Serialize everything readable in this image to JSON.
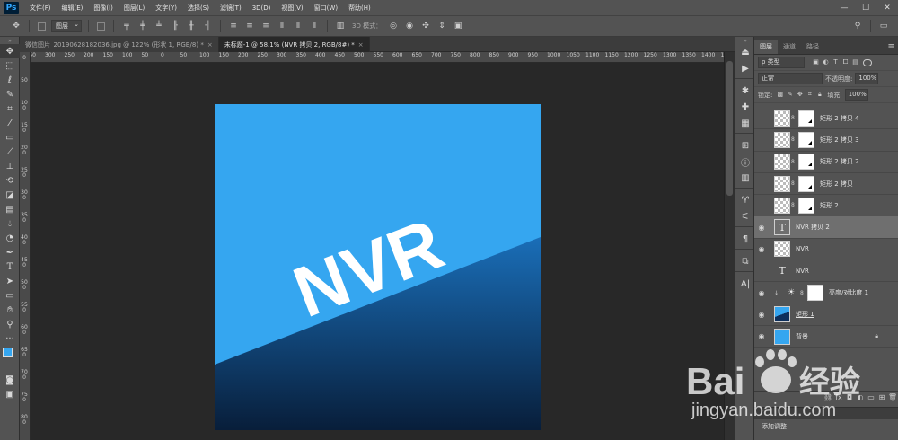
{
  "app": {
    "logo": "Ps"
  },
  "menus": [
    "文件(F)",
    "编辑(E)",
    "图像(I)",
    "图层(L)",
    "文字(Y)",
    "选择(S)",
    "滤镜(T)",
    "3D(D)",
    "视图(V)",
    "窗口(W)",
    "帮助(H)"
  ],
  "window_controls": {
    "minimize": "—",
    "maximize": "☐",
    "close": "✕"
  },
  "options_bar": {
    "layer_select": "图层",
    "mode_3d": "3D 模式：",
    "search": "⚲",
    "workspace": "▭"
  },
  "doc_tabs": [
    {
      "label": "微信图片_20190628182036.jpg @ 122% (形状 1, RGB/8) *",
      "close": "×"
    },
    {
      "label": "未标题-1 @ 58.1% (NVR 拷贝 2, RGB/8#) *",
      "close": "×"
    }
  ],
  "rulers": {
    "h": [
      "500",
      "450",
      "400",
      "350",
      "300",
      "250",
      "200",
      "150",
      "100",
      "50",
      "0",
      "50",
      "100",
      "150",
      "200",
      "250",
      "300",
      "350",
      "400",
      "450",
      "500",
      "550",
      "600",
      "650",
      "700",
      "750",
      "800",
      "850",
      "900",
      "950",
      "1000",
      "1050",
      "1100",
      "1150",
      "1200",
      "1250",
      "1300",
      "1350",
      "1400",
      "1450",
      "1500"
    ],
    "v": [
      "0",
      "50",
      "100",
      "150",
      "200",
      "250",
      "300",
      "350",
      "400",
      "450",
      "500",
      "550",
      "600",
      "650",
      "700",
      "750",
      "800"
    ]
  },
  "canvas": {
    "text": "NVR",
    "top_color": "#35a6f0",
    "bottom_color_top": "#1a6eb8",
    "bottom_color_bottom": "#081e3a"
  },
  "panels": {
    "tabs": [
      "图层",
      "通道",
      "路径"
    ],
    "menu": "≡",
    "filter_label": "ρ 类型",
    "blend_mode": "正常",
    "opacity_label": "不透明度:",
    "opacity_value": "100%",
    "lock_label": "锁定:",
    "fill_label": "填充:",
    "fill_value": "100%"
  },
  "layers": [
    {
      "name": "矩形 2 拷贝 4",
      "kind": "shape"
    },
    {
      "name": "矩形 2 拷贝 3",
      "kind": "shape"
    },
    {
      "name": "矩形 2 拷贝 2",
      "kind": "shape"
    },
    {
      "name": "矩形 2 拷贝",
      "kind": "shape"
    },
    {
      "name": "矩形 2",
      "kind": "shape"
    },
    {
      "name": "NVR 拷贝 2",
      "kind": "text",
      "selected": true
    },
    {
      "name": "NVR",
      "kind": "smart"
    },
    {
      "name": "NVR",
      "kind": "text"
    },
    {
      "name": "亮度/对比度 1",
      "kind": "adjust"
    },
    {
      "name": "矩形 1",
      "kind": "rect"
    },
    {
      "name": "背景",
      "kind": "background",
      "locked": true
    }
  ],
  "adjustments": {
    "title": "添加调整"
  },
  "watermark": {
    "brand": "Bai",
    "brand_cn": "经验",
    "url": "jingyan.baidu.com"
  }
}
